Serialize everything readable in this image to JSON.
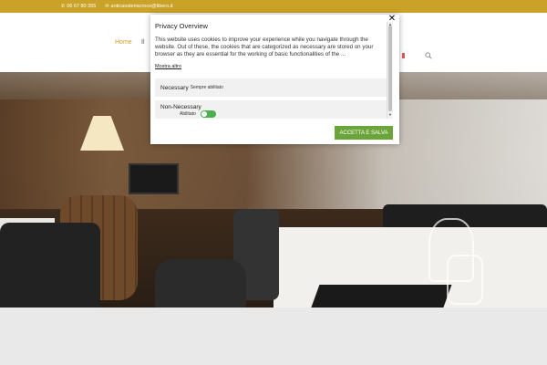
{
  "topbar": {
    "phone": "06 67 80 355",
    "email": "anticaosteriacroce@libero.it"
  },
  "nav": {
    "home": "Home",
    "next_item_partial": "Il"
  },
  "icons": {
    "phone": "phone-icon",
    "email": "mail-icon",
    "search": "search-icon",
    "close": "close-icon"
  },
  "cookie": {
    "title": "Privacy Overview",
    "body": "This website uses cookies to improve your experience while you navigate through the website. Out of these, the cookies that are categorized as necessary are stored on your browser as they are essential for the working of basic functionalities of the ...",
    "more": "Mostra altro",
    "necessary_label": "Necessary",
    "necessary_status": "Sempre abilitato",
    "non_necessary_label": "Non-Necessary",
    "non_necessary_status": "Abilitato",
    "accept": "ACCETTA E SALVA"
  },
  "colors": {
    "brand_gold": "#c9a227",
    "accept_green": "#6ba539",
    "toggle_green": "#4caf50"
  }
}
